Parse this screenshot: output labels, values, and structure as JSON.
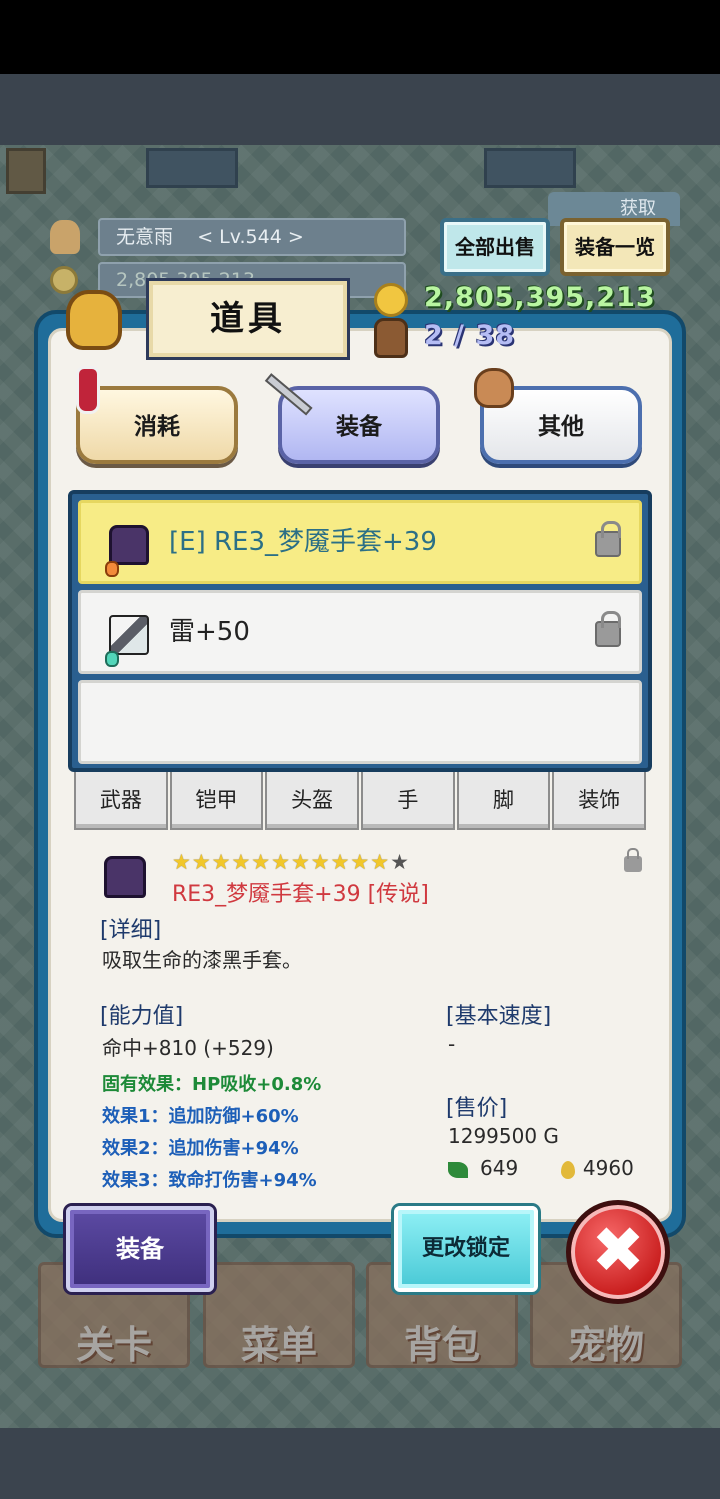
{
  "hud": {
    "player_name": "无意雨",
    "level": "< Lv.544 >",
    "gold_ghost": "2,805,395,213",
    "acquire_tab": "获取"
  },
  "top_buttons": {
    "sell_all": "全部出售",
    "equip_list": "装备一览"
  },
  "wallet": {
    "gold": "2,805,395,213",
    "bag": "2 / 38"
  },
  "panel": {
    "title": "道具"
  },
  "categories": [
    {
      "label": "消耗",
      "icon": "potion-icon"
    },
    {
      "label": "装备",
      "icon": "sword-icon",
      "selected": true
    },
    {
      "label": "其他",
      "icon": "sack-icon"
    }
  ],
  "items": [
    {
      "label": "[E] RE3_梦魇手套+39",
      "icon": "gauntlet-icon",
      "selected": true,
      "locked": true
    },
    {
      "label": "雷+50",
      "icon": "wand-icon",
      "selected": false,
      "locked": true
    }
  ],
  "slot_tabs": [
    "武器",
    "铠甲",
    "头盔",
    "手",
    "脚",
    "装饰"
  ],
  "detail": {
    "stars_on": "★★★★★★★★★★★",
    "stars_off": "★",
    "name": "RE3_梦魇手套+39 [传说]",
    "desc_head": "[详细]",
    "desc": "吸取生命的漆黑手套。",
    "stats_head": "[能力值]",
    "stat": "命中+810 (+529)",
    "speed_head": "[基本速度]",
    "speed": "-",
    "inherent": "固有效果：HP吸收+0.8%",
    "effect1": "效果1：追加防御+60%",
    "effect2": "效果2：追加伤害+94%",
    "effect3": "效果3：致命打伤害+94%",
    "price_head": "[售价]",
    "price": "1299500 G",
    "leaf_value": "649",
    "drop_value": "4960"
  },
  "nav": [
    "关卡",
    "菜单",
    "背包",
    "宠物"
  ],
  "actions": {
    "equip": "装备",
    "change_lock": "更改锁定",
    "close": "✖"
  },
  "colors": {
    "panel_border": "#1f6d9a",
    "selected_row": "#f7ec86",
    "legend_name": "#d0393f",
    "gold_text": "#b9f5a1"
  }
}
